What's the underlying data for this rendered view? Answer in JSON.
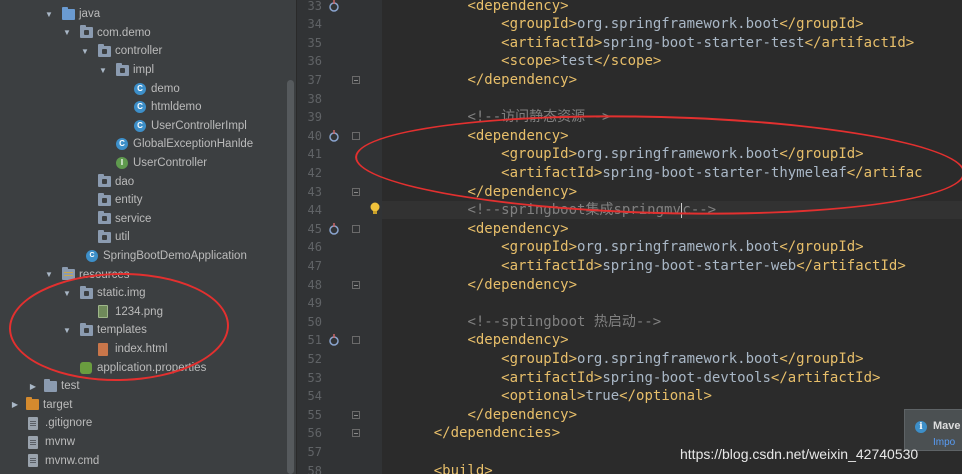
{
  "project_tree": {
    "items": [
      {
        "label": "java",
        "icon": "source-folder-icon",
        "arrow": "open"
      },
      {
        "label": "com.demo",
        "icon": "package-icon",
        "arrow": "open"
      },
      {
        "label": "controller",
        "icon": "package-icon",
        "arrow": "open"
      },
      {
        "label": "impl",
        "icon": "package-icon",
        "arrow": "open"
      },
      {
        "label": "demo",
        "icon": "class-icon"
      },
      {
        "label": "htmldemo",
        "icon": "class-icon"
      },
      {
        "label": "UserControllerImpl",
        "icon": "class-icon"
      },
      {
        "label": "GlobalExceptionHanlde",
        "icon": "class-icon"
      },
      {
        "label": "UserController",
        "icon": "interface-icon"
      },
      {
        "label": "dao",
        "icon": "package-icon"
      },
      {
        "label": "entity",
        "icon": "package-icon"
      },
      {
        "label": "service",
        "icon": "package-icon"
      },
      {
        "label": "util",
        "icon": "package-icon"
      },
      {
        "label": "SpringBootDemoApplication",
        "icon": "spring-app-icon"
      },
      {
        "label": "resources",
        "icon": "resources-folder-icon",
        "arrow": "open"
      },
      {
        "label": "static.img",
        "icon": "package-icon",
        "arrow": "open"
      },
      {
        "label": "1234.png",
        "icon": "image-file-icon"
      },
      {
        "label": "templates",
        "icon": "package-icon",
        "arrow": "open"
      },
      {
        "label": "index.html",
        "icon": "html-file-icon"
      },
      {
        "label": "application.properties",
        "icon": "properties-file-icon"
      },
      {
        "label": "test",
        "icon": "folder-icon",
        "arrow": "closed"
      },
      {
        "label": "target",
        "icon": "excluded-folder-icon",
        "arrow": "closed"
      },
      {
        "label": ".gitignore",
        "icon": "text-file-icon"
      },
      {
        "label": "mvnw",
        "icon": "text-file-icon"
      },
      {
        "label": "mvnw.cmd",
        "icon": "text-file-icon"
      }
    ]
  },
  "editor": {
    "lines": [
      {
        "n": "33",
        "indent": 8,
        "parts": [
          {
            "t": "<dependency>",
            "c": "tag"
          }
        ]
      },
      {
        "n": "34",
        "indent": 12,
        "parts": [
          {
            "t": "<groupId>",
            "c": "tag"
          },
          {
            "t": "org.springframework.boot",
            "c": "txt"
          },
          {
            "t": "</groupId>",
            "c": "tag"
          }
        ]
      },
      {
        "n": "35",
        "indent": 12,
        "parts": [
          {
            "t": "<artifactId>",
            "c": "tag"
          },
          {
            "t": "spring-boot-starter-test",
            "c": "txt"
          },
          {
            "t": "</artifactId>",
            "c": "tag"
          }
        ]
      },
      {
        "n": "36",
        "indent": 12,
        "parts": [
          {
            "t": "<scope>",
            "c": "tag"
          },
          {
            "t": "test",
            "c": "txt"
          },
          {
            "t": "</scope>",
            "c": "tag"
          }
        ]
      },
      {
        "n": "37",
        "indent": 8,
        "parts": [
          {
            "t": "</dependency>",
            "c": "tag"
          }
        ]
      },
      {
        "n": "38",
        "indent": 0,
        "parts": []
      },
      {
        "n": "39",
        "indent": 8,
        "parts": [
          {
            "t": "<!--访问静态资源-->",
            "c": "cmt"
          }
        ]
      },
      {
        "n": "40",
        "indent": 8,
        "parts": [
          {
            "t": "<dependency>",
            "c": "tag"
          }
        ]
      },
      {
        "n": "41",
        "indent": 12,
        "parts": [
          {
            "t": "<groupId>",
            "c": "tag"
          },
          {
            "t": "org.springframework.boot",
            "c": "txt"
          },
          {
            "t": "</groupId>",
            "c": "tag"
          }
        ]
      },
      {
        "n": "42",
        "indent": 12,
        "parts": [
          {
            "t": "<artifactId>",
            "c": "tag"
          },
          {
            "t": "spring-boot-starter-thymeleaf",
            "c": "txt"
          },
          {
            "t": "</artifac",
            "c": "tag"
          }
        ]
      },
      {
        "n": "43",
        "indent": 8,
        "parts": [
          {
            "t": "</dependency>",
            "c": "tag"
          }
        ]
      },
      {
        "n": "44",
        "indent": 8,
        "parts": [
          {
            "t": "<!--",
            "c": "cmt"
          },
          {
            "t": "springboot",
            "c": "cmt squiggle"
          },
          {
            "t": "集成",
            "c": "cmt"
          },
          {
            "t": "springmv",
            "c": "cmt squiggle"
          },
          {
            "t": "|",
            "c": "caret"
          },
          {
            "t": "c-->",
            "c": "cmt"
          }
        ]
      },
      {
        "n": "45",
        "indent": 8,
        "parts": [
          {
            "t": "<dependency>",
            "c": "tag"
          }
        ]
      },
      {
        "n": "46",
        "indent": 12,
        "parts": [
          {
            "t": "<groupId>",
            "c": "tag"
          },
          {
            "t": "org.springframework.boot",
            "c": "txt"
          },
          {
            "t": "</groupId>",
            "c": "tag"
          }
        ]
      },
      {
        "n": "47",
        "indent": 12,
        "parts": [
          {
            "t": "<artifactId>",
            "c": "tag"
          },
          {
            "t": "spring-boot-starter-web",
            "c": "txt"
          },
          {
            "t": "</artifactId>",
            "c": "tag"
          }
        ]
      },
      {
        "n": "48",
        "indent": 8,
        "parts": [
          {
            "t": "</dependency>",
            "c": "tag"
          }
        ]
      },
      {
        "n": "49",
        "indent": 0,
        "parts": []
      },
      {
        "n": "50",
        "indent": 8,
        "parts": [
          {
            "t": "<!--",
            "c": "cmt"
          },
          {
            "t": "sptingboot",
            "c": "cmt squiggle"
          },
          {
            "t": " 热启动-->",
            "c": "cmt"
          }
        ]
      },
      {
        "n": "51",
        "indent": 8,
        "parts": [
          {
            "t": "<dependency>",
            "c": "tag"
          }
        ]
      },
      {
        "n": "52",
        "indent": 12,
        "parts": [
          {
            "t": "<groupId>",
            "c": "tag"
          },
          {
            "t": "org.springframework.boot",
            "c": "txt"
          },
          {
            "t": "</groupId>",
            "c": "tag"
          }
        ]
      },
      {
        "n": "53",
        "indent": 12,
        "parts": [
          {
            "t": "<artifactId>",
            "c": "tag"
          },
          {
            "t": "spring-boot-devtools",
            "c": "txt"
          },
          {
            "t": "</artifactId>",
            "c": "tag"
          }
        ]
      },
      {
        "n": "54",
        "indent": 12,
        "parts": [
          {
            "t": "<optional>",
            "c": "tag"
          },
          {
            "t": "true",
            "c": "txt"
          },
          {
            "t": "</optional>",
            "c": "tag"
          }
        ]
      },
      {
        "n": "55",
        "indent": 8,
        "parts": [
          {
            "t": "</dependency>",
            "c": "tag"
          }
        ]
      },
      {
        "n": "56",
        "indent": 4,
        "parts": [
          {
            "t": "</dependencies>",
            "c": "tag"
          }
        ]
      },
      {
        "n": "57",
        "indent": 0,
        "parts": []
      },
      {
        "n": "58",
        "indent": 4,
        "parts": [
          {
            "t": "<build>",
            "c": "tag"
          }
        ]
      }
    ]
  },
  "notification": {
    "title": "Mave",
    "link": "Impo"
  },
  "watermark": "https://blog.csdn.net/weixin_42740530",
  "colors": {
    "tag": "#e8bf6a",
    "text": "#a9b7c6",
    "comment": "#808080",
    "annotation_red": "#e3302f"
  }
}
